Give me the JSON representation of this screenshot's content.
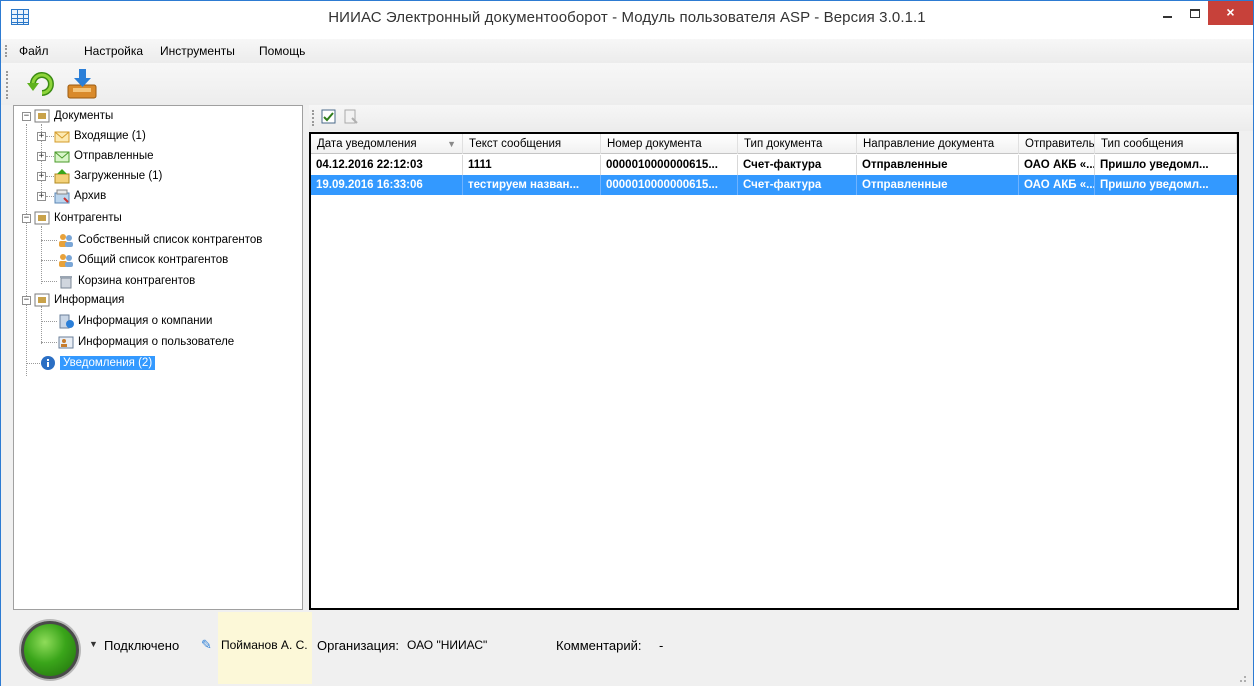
{
  "window": {
    "title": "НИИАС Электронный документооборот - Модуль пользователя ASP - Версия 3.0.1.1",
    "close_glyph": "×"
  },
  "menu": [
    "Файл",
    "Настройка",
    "Инструменты",
    "Помощь"
  ],
  "tree": {
    "documents": "Документы",
    "incoming": "Входящие (1)",
    "sent": "Отправленные",
    "uploaded": "Загруженные (1)",
    "archive": "Архив",
    "contractors": "Контрагенты",
    "own_list": "Собственный список контрагентов",
    "common_list": "Общий список контрагентов",
    "trash": "Корзина контрагентов",
    "information": "Информация",
    "company_info": "Информация о компании",
    "user_info": "Информация о пользователе",
    "notifications": "Уведомления (2)"
  },
  "grid": {
    "columns": [
      "Дата уведомления",
      "Текст сообщения",
      "Номер документа",
      "Тип документа",
      "Направление документа",
      "Отправитель",
      "Тип сообщения"
    ],
    "rows": [
      [
        "04.12.2016 22:12:03",
        "1111",
        "0000010000000615...",
        "Счет-фактура",
        "Отправленные",
        "ОАО АКБ «...",
        "Пришло уведомл..."
      ],
      [
        "19.09.2016 16:33:06",
        "тестируем назван...",
        "0000010000000615...",
        "Счет-фактура",
        "Отправленные",
        "ОАО АКБ «...",
        "Пришло уведомл..."
      ]
    ],
    "selected_row": 1
  },
  "status": {
    "connection": "Подключено",
    "user": "Пойманов А. С.",
    "org_label": "Организация:",
    "org_value": "ОАО \"НИИАС\"",
    "comment_label": "Комментарий:",
    "comment_value": "-"
  },
  "colors": {
    "selection": "#3399ff",
    "close_button": "#c7413a",
    "status_led": "#3aa51a",
    "user_highlight": "#fcf8d8"
  }
}
